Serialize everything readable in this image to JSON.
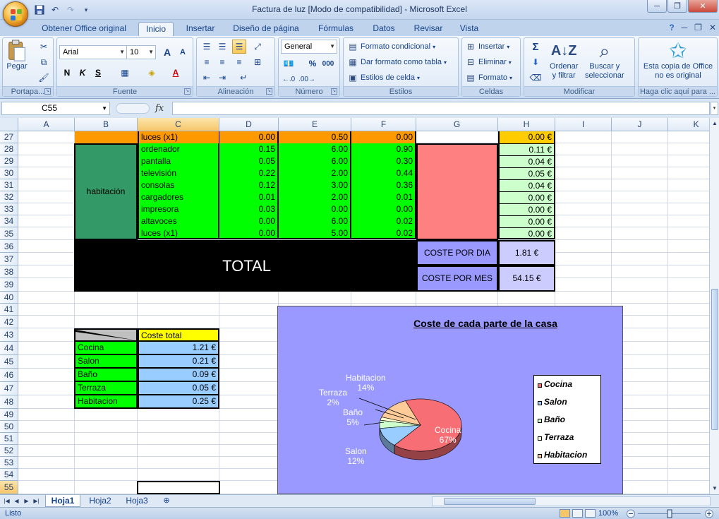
{
  "window": {
    "title": "Factura de luz  [Modo de compatibilidad] - Microsoft Excel",
    "minimize": "─",
    "restore": "❐",
    "close": "✕"
  },
  "ribbon_tabs": [
    "Obtener Office original",
    "Inicio",
    "Insertar",
    "Diseño de página",
    "Fórmulas",
    "Datos",
    "Revisar",
    "Vista"
  ],
  "ribbon": {
    "clipboard": {
      "paste": "Pegar",
      "label": "Portapa..."
    },
    "font": {
      "name": "Arial",
      "size": "10",
      "grow": "A",
      "shrink": "A",
      "bold": "N",
      "italic": "K",
      "underline": "S",
      "label": "Fuente"
    },
    "alignment": {
      "label": "Alineación"
    },
    "number": {
      "format": "General",
      "percent": "%",
      "thousands": "000",
      "label": "Número"
    },
    "styles": {
      "conditional": "Formato condicional",
      "table": "Dar formato como tabla",
      "cell_styles": "Estilos de celda",
      "label": "Estilos"
    },
    "cells": {
      "insert": "Insertar",
      "delete": "Eliminar",
      "format": "Formato",
      "label": "Celdas"
    },
    "editing": {
      "sort_line1": "Ordenar",
      "sort_line2": "y filtrar",
      "find_line1": "Buscar y",
      "find_line2": "seleccionar",
      "label": "Modificar"
    },
    "office": {
      "line1": "Esta copia de Office",
      "line2": "no es original",
      "label": "Haga clic aquí para ..."
    }
  },
  "formula_bar": {
    "name_box": "C55",
    "fx": "fx",
    "value": ""
  },
  "columns": [
    "A",
    "B",
    "C",
    "D",
    "E",
    "F",
    "G",
    "H",
    "I",
    "J",
    "K"
  ],
  "rows": [
    "27",
    "28",
    "29",
    "30",
    "31",
    "32",
    "33",
    "34",
    "35",
    "36",
    "37",
    "38",
    "39",
    "40",
    "41",
    "42",
    "43",
    "44",
    "45",
    "46",
    "47",
    "48",
    "49",
    "50",
    "51",
    "52",
    "53",
    "54",
    "55"
  ],
  "table_top": {
    "row27": {
      "item": "luces (x1)",
      "d": "0.00",
      "e": "0.50",
      "f": "0.00",
      "h": "0.00 €"
    },
    "room": "habitación",
    "rows": [
      {
        "item": "ordenador",
        "d": "0.15",
        "e": "6.00",
        "f": "0.90",
        "h": "0.11 €"
      },
      {
        "item": "pantalla",
        "d": "0.05",
        "e": "6.00",
        "f": "0.30",
        "h": "0.04 €"
      },
      {
        "item": "televisión",
        "d": "0.22",
        "e": "2.00",
        "f": "0.44",
        "h": "0.05 €"
      },
      {
        "item": "consolas",
        "d": "0.12",
        "e": "3.00",
        "f": "0.36",
        "h": "0.04 €"
      },
      {
        "item": "cargadores",
        "d": "0.01",
        "e": "2.00",
        "f": "0.01",
        "h": "0.00 €"
      },
      {
        "item": "impresora",
        "d": "0.03",
        "e": "0.00",
        "f": "0.00",
        "h": "0.00 €"
      },
      {
        "item": "altavoces",
        "d": "0.00",
        "e": "6.00",
        "f": "0.02",
        "h": "0.00 €"
      },
      {
        "item": "luces (x1)",
        "d": "0.00",
        "e": "5.00",
        "f": "0.02",
        "h": "0.00 €"
      }
    ],
    "total_label": "TOTAL",
    "cost_day_label": "COSTE POR DIA",
    "cost_day_value": "1.81 €",
    "cost_month_label": "COSTE POR MES",
    "cost_month_value": "54.15 €"
  },
  "summary": {
    "header": "Coste total",
    "rows": [
      {
        "name": "Cocina",
        "value": "1.21 €"
      },
      {
        "name": "Salon",
        "value": "0.21 €"
      },
      {
        "name": "Baño",
        "value": "0.09 €"
      },
      {
        "name": "Terraza",
        "value": "0.05 €"
      },
      {
        "name": "Habitacion",
        "value": "0.25 €"
      }
    ]
  },
  "chart_data": {
    "type": "pie",
    "title": "Coste de cada parte de la casa",
    "categories": [
      "Cocina",
      "Salon",
      "Baño",
      "Terraza",
      "Habitacion"
    ],
    "values": [
      67,
      12,
      5,
      2,
      14
    ],
    "labels": [
      "67%",
      "12%",
      "5%",
      "2%",
      "14%"
    ],
    "legend_position": "right",
    "colors": [
      "#f76e74",
      "#99ccff",
      "#ccffcc",
      "#ffffcc",
      "#ffcc99"
    ]
  },
  "sheet_tabs": [
    "Hoja1",
    "Hoja2",
    "Hoja3"
  ],
  "status": {
    "text": "Listo",
    "zoom": "100%"
  },
  "colors": {
    "orange": "#ff9900",
    "green": "#00ff00",
    "dark_green": "#339966",
    "salmon": "#ff8080",
    "light_green": "#ccffcc",
    "lavender": "#9999ff",
    "black": "#000000",
    "yellow": "#ffff00",
    "light_blue": "#99ccff",
    "gray": "#c0c0c0"
  }
}
